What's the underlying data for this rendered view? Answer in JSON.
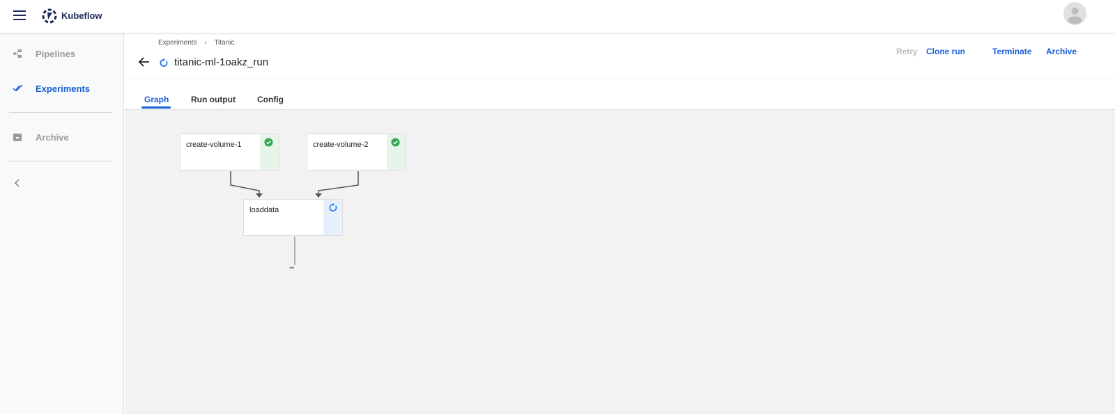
{
  "app": {
    "brand": "Kubeflow"
  },
  "sidebar": {
    "items": [
      {
        "label": "Pipelines",
        "icon": "pipelines-icon"
      },
      {
        "label": "Experiments",
        "icon": "experiments-icon",
        "active": true
      },
      {
        "label": "Archive",
        "icon": "archive-icon"
      }
    ]
  },
  "header": {
    "breadcrumb": [
      "Experiments",
      "Titanic"
    ],
    "breadcrumb_sep": "›",
    "title": "titanic-ml-1oakz_run",
    "status": "running"
  },
  "actions": {
    "retry": "Retry",
    "clone": "Clone run",
    "terminate": "Terminate",
    "archive": "Archive"
  },
  "tabs": [
    {
      "label": "Graph",
      "active": true
    },
    {
      "label": "Run output"
    },
    {
      "label": "Config"
    }
  ],
  "graph": {
    "nodes": [
      {
        "name": "create-volume-1",
        "status": "succeeded"
      },
      {
        "name": "create-volume-2",
        "status": "succeeded"
      },
      {
        "name": "loaddata",
        "status": "running"
      }
    ],
    "more": "•••"
  },
  "colors": {
    "accent": "#1a5fd6",
    "success": "#34a853",
    "success_bg": "#e6f4ea",
    "running_bg": "#e8f0fe"
  }
}
